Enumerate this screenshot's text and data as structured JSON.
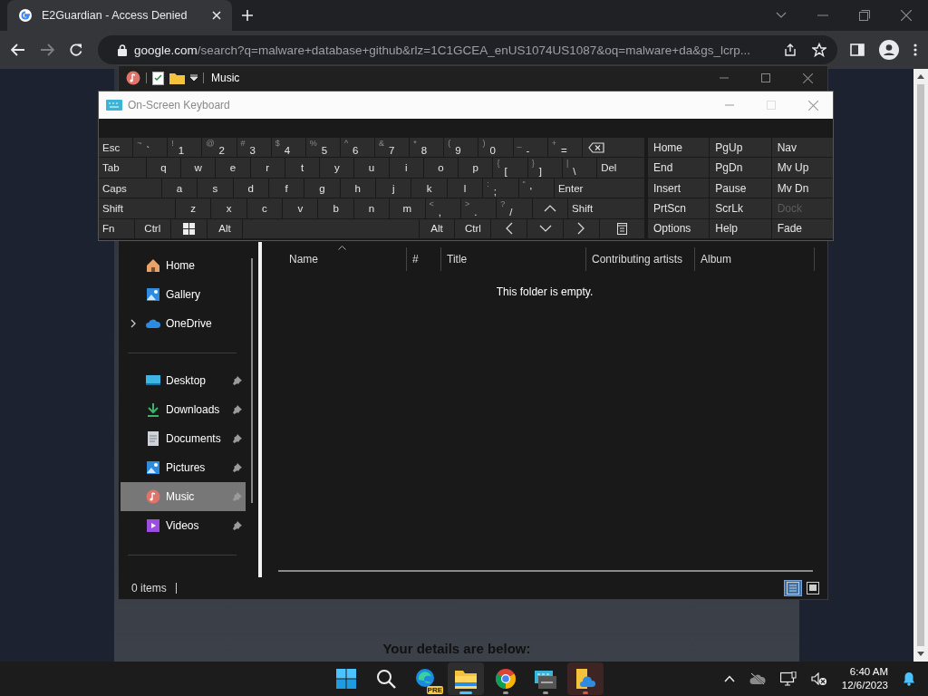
{
  "browser": {
    "tab": {
      "title": "E2Guardian - Access Denied",
      "selected": true
    },
    "address": {
      "host": "google.com",
      "path": "/search?q=malware+database+github&rlz=1C1GCEA_enUS1074US1087&oq=malware+da&gs_lcrp..."
    }
  },
  "page": {
    "heading": "Your details are below:"
  },
  "explorer": {
    "title": "Music",
    "sidebar": [
      [
        {
          "label": "Home",
          "kind": "home",
          "pinned": false,
          "expandable": false,
          "selected": false
        },
        {
          "label": "Gallery",
          "kind": "gallery",
          "pinned": false,
          "expandable": false,
          "selected": false
        },
        {
          "label": "OneDrive",
          "kind": "cloud",
          "pinned": false,
          "expandable": true,
          "selected": false
        }
      ],
      [
        {
          "label": "Desktop",
          "kind": "desktop",
          "pinned": true,
          "expandable": false,
          "selected": false
        },
        {
          "label": "Downloads",
          "kind": "download",
          "pinned": true,
          "expandable": false,
          "selected": false
        },
        {
          "label": "Documents",
          "kind": "document",
          "pinned": true,
          "expandable": false,
          "selected": false
        },
        {
          "label": "Pictures",
          "kind": "picture",
          "pinned": true,
          "expandable": false,
          "selected": false
        },
        {
          "label": "Music",
          "kind": "music",
          "pinned": true,
          "expandable": false,
          "selected": true
        },
        {
          "label": "Videos",
          "kind": "video",
          "pinned": true,
          "expandable": false,
          "selected": false
        }
      ]
    ],
    "columns": [
      "Name",
      "#",
      "Title",
      "Contributing artists",
      "Album"
    ],
    "empty_message": "This folder is empty.",
    "status": "0 items",
    "views": [
      {
        "kind": "details",
        "selected": true
      },
      {
        "kind": "tiles",
        "selected": false
      }
    ]
  },
  "keyboard": {
    "title": "On-Screen Keyboard",
    "rows": [
      [
        {
          "kind": "key",
          "label": "Esc"
        },
        {
          "kind": "key",
          "shift": "~",
          "label": "`"
        },
        {
          "kind": "key",
          "shift": "!",
          "label": "1"
        },
        {
          "kind": "key",
          "shift": "@",
          "label": "2"
        },
        {
          "kind": "key",
          "shift": "#",
          "label": "3"
        },
        {
          "kind": "key",
          "shift": "$",
          "label": "4"
        },
        {
          "kind": "key",
          "shift": "%",
          "label": "5"
        },
        {
          "kind": "key",
          "shift": "^",
          "label": "6"
        },
        {
          "kind": "key",
          "shift": "&",
          "label": "7"
        },
        {
          "kind": "key",
          "shift": "*",
          "label": "8"
        },
        {
          "kind": "key",
          "shift": "(",
          "label": "9"
        },
        {
          "kind": "key",
          "shift": ")",
          "label": "0"
        },
        {
          "kind": "key",
          "shift": "_",
          "label": "-"
        },
        {
          "kind": "key",
          "shift": "+",
          "label": "="
        },
        {
          "kind": "backspace"
        }
      ],
      [
        {
          "kind": "tab",
          "label": "Tab"
        },
        {
          "kind": "key",
          "label": "q"
        },
        {
          "kind": "key",
          "label": "w"
        },
        {
          "kind": "key",
          "label": "e"
        },
        {
          "kind": "key",
          "label": "r"
        },
        {
          "kind": "key",
          "label": "t"
        },
        {
          "kind": "key",
          "label": "y"
        },
        {
          "kind": "key",
          "label": "u"
        },
        {
          "kind": "key",
          "label": "i"
        },
        {
          "kind": "key",
          "label": "o"
        },
        {
          "kind": "key",
          "label": "p"
        },
        {
          "kind": "key",
          "shift": "{",
          "label": "["
        },
        {
          "kind": "key",
          "shift": "}",
          "label": "]"
        },
        {
          "kind": "key",
          "shift": "|",
          "label": "\\"
        },
        {
          "kind": "tab",
          "label": "Del"
        }
      ],
      [
        {
          "kind": "caps",
          "label": "Caps"
        },
        {
          "kind": "key",
          "label": "a"
        },
        {
          "kind": "key",
          "label": "s"
        },
        {
          "kind": "key",
          "label": "d"
        },
        {
          "kind": "key",
          "label": "f"
        },
        {
          "kind": "key",
          "label": "g"
        },
        {
          "kind": "key",
          "label": "h"
        },
        {
          "kind": "key",
          "label": "j"
        },
        {
          "kind": "key",
          "label": "k"
        },
        {
          "kind": "key",
          "label": "l"
        },
        {
          "kind": "key",
          "shift": ":",
          "label": ";"
        },
        {
          "kind": "key",
          "shift": "\"",
          "label": "'"
        },
        {
          "kind": "enter",
          "label": "Enter"
        }
      ],
      [
        {
          "kind": "shift",
          "label": "Shift"
        },
        {
          "kind": "key",
          "label": "z"
        },
        {
          "kind": "key",
          "label": "x"
        },
        {
          "kind": "key",
          "label": "c"
        },
        {
          "kind": "key",
          "label": "v"
        },
        {
          "kind": "key",
          "label": "b"
        },
        {
          "kind": "key",
          "label": "n"
        },
        {
          "kind": "key",
          "label": "m"
        },
        {
          "kind": "key",
          "shift": "<",
          "label": ","
        },
        {
          "kind": "key",
          "shift": ">",
          "label": "."
        },
        {
          "kind": "key",
          "shift": "?",
          "label": "/"
        },
        {
          "kind": "up"
        },
        {
          "kind": "shift",
          "label": "Shift"
        }
      ],
      [
        {
          "kind": "key",
          "label": "Fn"
        },
        {
          "kind": "key",
          "label": "Ctrl"
        },
        {
          "kind": "win"
        },
        {
          "kind": "key",
          "label": "Alt"
        },
        {
          "kind": "space"
        },
        {
          "kind": "key",
          "label": "Alt"
        },
        {
          "kind": "key",
          "label": "Ctrl"
        },
        {
          "kind": "left"
        },
        {
          "kind": "down"
        },
        {
          "kind": "right"
        },
        {
          "kind": "menu"
        }
      ]
    ],
    "nav": [
      [
        {
          "label": "Home",
          "disabled": false
        },
        {
          "label": "PgUp",
          "disabled": false
        },
        {
          "label": "Nav",
          "disabled": false
        }
      ],
      [
        {
          "label": "End",
          "disabled": false
        },
        {
          "label": "PgDn",
          "disabled": false
        },
        {
          "label": "Mv Up",
          "disabled": false
        }
      ],
      [
        {
          "label": "Insert",
          "disabled": false
        },
        {
          "label": "Pause",
          "disabled": false
        },
        {
          "label": "Mv Dn",
          "disabled": false
        }
      ],
      [
        {
          "label": "PrtScn",
          "disabled": false
        },
        {
          "label": "ScrLk",
          "disabled": false
        },
        {
          "label": "Dock",
          "disabled": true
        }
      ],
      [
        {
          "label": "Options",
          "disabled": false
        },
        {
          "label": "Help",
          "disabled": false
        },
        {
          "label": "Fade",
          "disabled": false
        }
      ]
    ]
  },
  "taskbar": {
    "apps": [
      {
        "kind": "start",
        "running": false,
        "selected": false,
        "attention": false
      },
      {
        "kind": "search",
        "running": false,
        "selected": false,
        "attention": false
      },
      {
        "kind": "edge",
        "badge": "PRE",
        "running": false,
        "selected": false,
        "attention": false
      },
      {
        "kind": "explorer",
        "running": true,
        "selected": true,
        "attention": false
      },
      {
        "kind": "chrome",
        "running": true,
        "selected": false,
        "attention": false
      },
      {
        "kind": "keyboard",
        "running": true,
        "selected": false,
        "attention": false
      },
      {
        "kind": "explorer-cloud",
        "running": true,
        "selected": false,
        "attention": true
      }
    ],
    "tray": [
      {
        "kind": "chevron"
      },
      {
        "kind": "cloud-off"
      },
      {
        "kind": "monitor"
      },
      {
        "kind": "mute"
      }
    ],
    "time": "6:40 AM",
    "date": "12/6/2023"
  }
}
